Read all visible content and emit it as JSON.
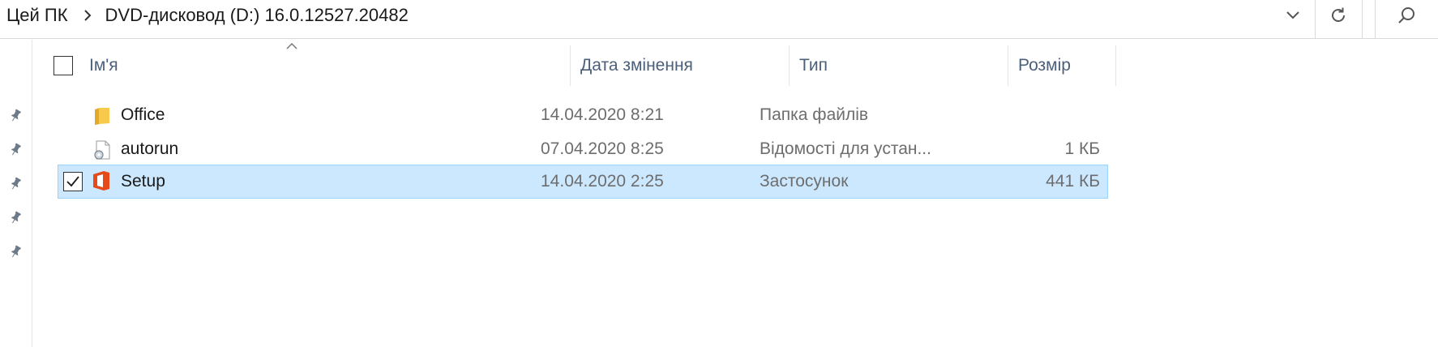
{
  "breadcrumb": {
    "items": [
      "Цей ПК",
      "DVD-дисковод (D:) 16.0.12527.20482"
    ]
  },
  "toolbar": {
    "dropdown_icon": "chevron-down-icon",
    "refresh_icon": "refresh-icon",
    "search_icon": "search-icon"
  },
  "columns": {
    "name": "Ім'я",
    "date": "Дата змінення",
    "type": "Тип",
    "size": "Розмір",
    "sort": "ascending"
  },
  "rows": [
    {
      "name": "Office",
      "date": "14.04.2020 8:21",
      "type": "Папка файлів",
      "size": "",
      "icon": "folder-icon",
      "selected": false
    },
    {
      "name": "autorun",
      "date": "07.04.2020 8:25",
      "type": "Відомості для устан...",
      "size": "1 КБ",
      "icon": "setup-info-file-icon",
      "selected": false
    },
    {
      "name": "Setup",
      "date": "14.04.2020 2:25",
      "type": "Застосунок",
      "size": "441 КБ",
      "icon": "office-app-icon",
      "selected": true
    }
  ],
  "colors": {
    "selection_bg": "#cce8ff",
    "selection_border": "#99d1ff",
    "header_text": "#4c607a",
    "office_red": "#e64a19",
    "folder_yellow": "#f8c94a"
  },
  "nav_pins": 5
}
